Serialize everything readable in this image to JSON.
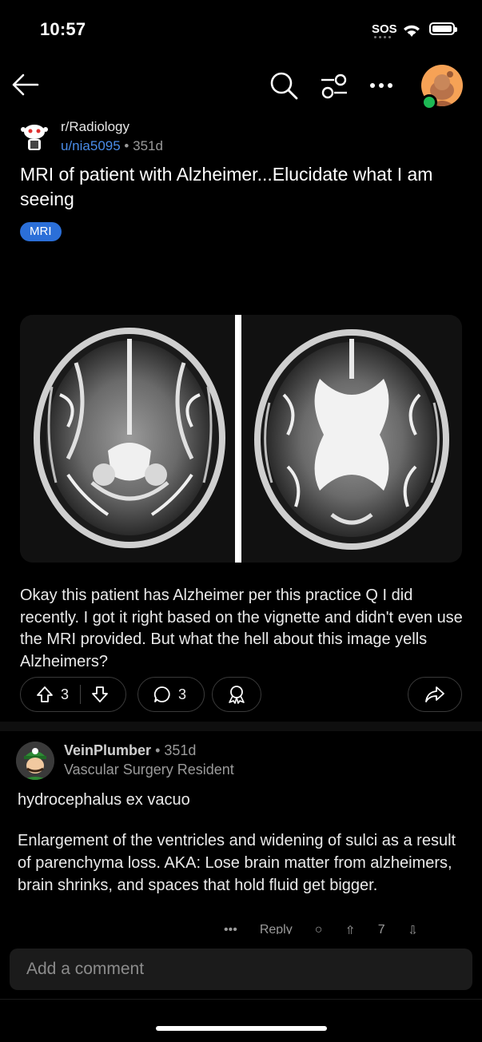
{
  "status_bar": {
    "time": "10:57",
    "sos": "SOS"
  },
  "header": {
    "icons": [
      "back-arrow-icon",
      "search-icon",
      "filter-icon",
      "more-icon"
    ]
  },
  "post": {
    "subreddit": "r/Radiology",
    "user": "u/nia5095",
    "separator": "•",
    "age": "351d",
    "title": "MRI of patient with Alzheimer...Elucidate what I am seeing",
    "flair": "MRI",
    "body": "Okay this patient has Alzheimer per this practice Q I did recently. I got it right based on the vignette and didn't even use the MRI provided. But what the hell about this image yells Alzheimers?",
    "votes": "3",
    "comments": "3"
  },
  "comment": {
    "author": "VeinPlumber",
    "age": "351d",
    "flair": "Vascular Surgery Resident",
    "paragraph1": "hydrocephalus ex vacuo",
    "paragraph2": "Enlargement of the ventricles and widening of sulci as a result of parenchyma loss. AKA: Lose brain matter from alzheimers, brain shrinks, and spaces that hold fluid get bigger.",
    "actions": {
      "reply": "Reply",
      "votes": "7"
    }
  },
  "composer": {
    "placeholder": "Add a comment"
  },
  "colors": {
    "accent": "#2b6fd8",
    "link": "#4a8ce8",
    "online": "#1db954"
  }
}
